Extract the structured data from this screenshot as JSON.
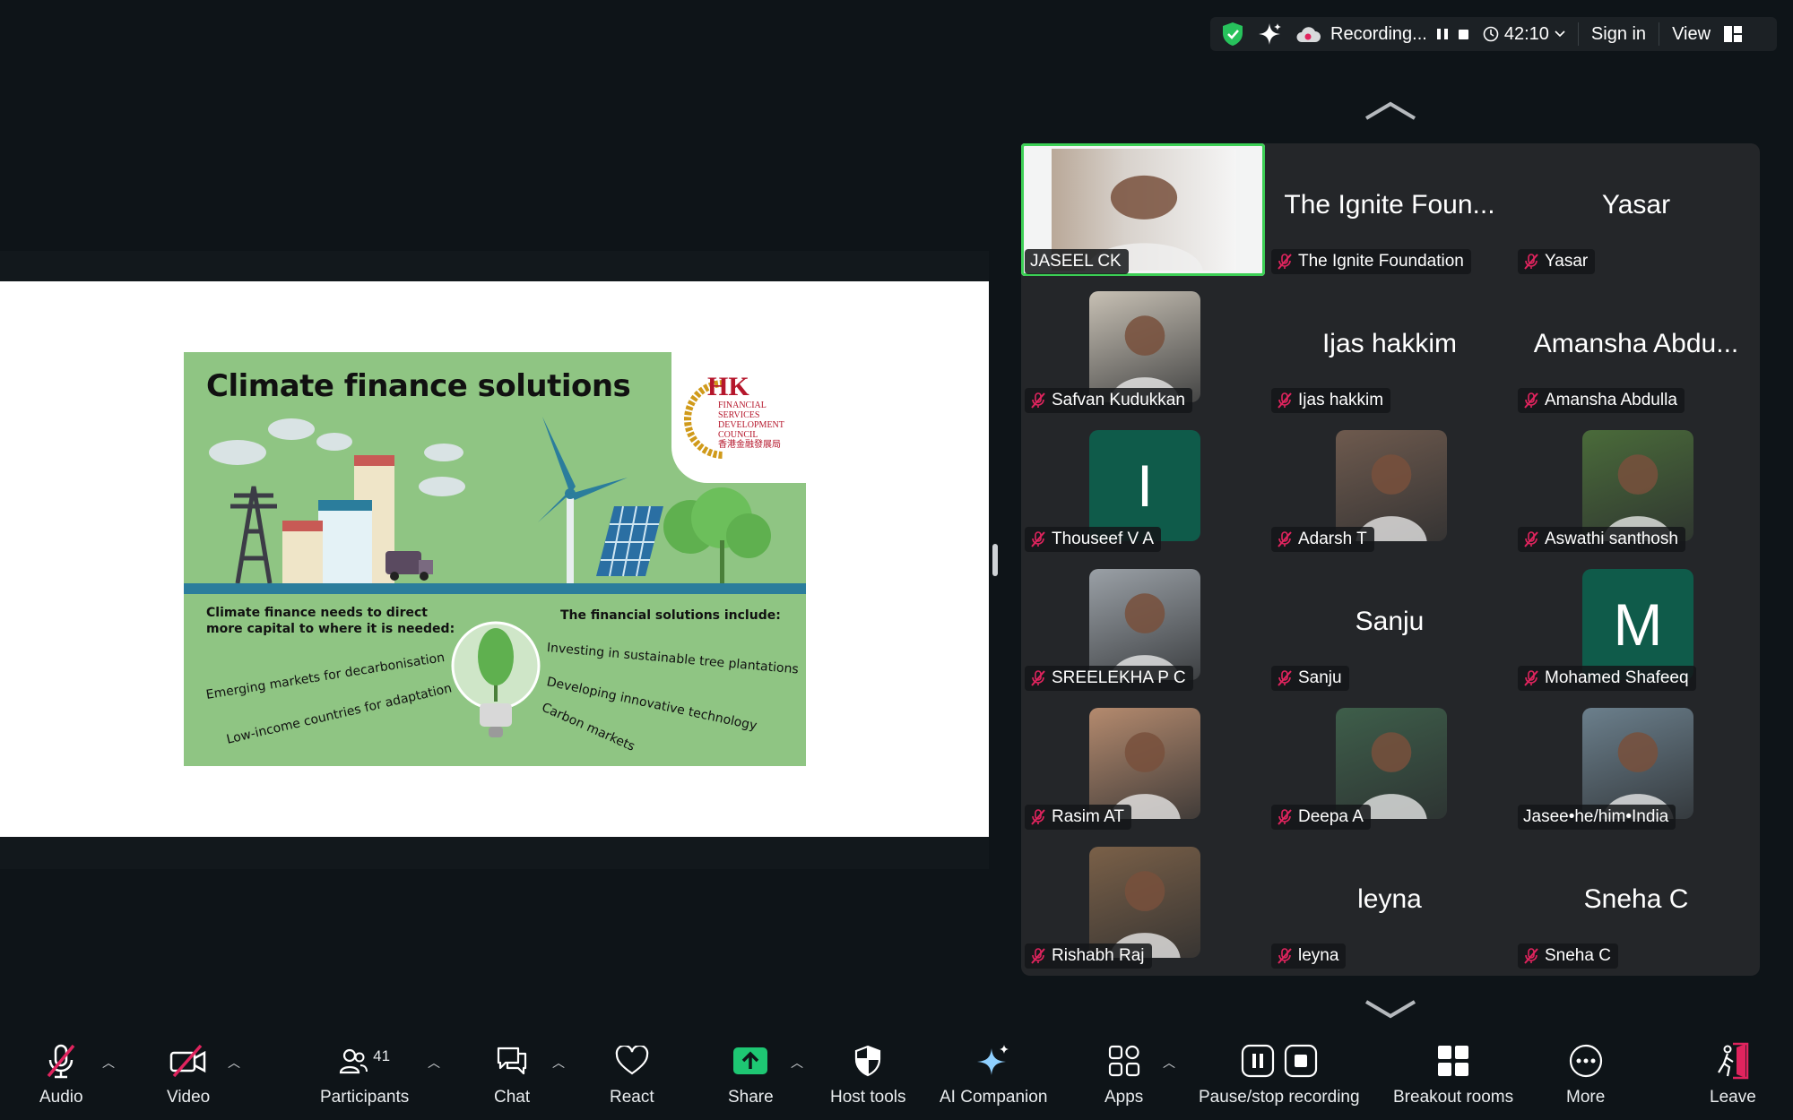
{
  "topbar": {
    "recording_label": "Recording...",
    "timer": "42:10",
    "sign_in": "Sign in",
    "view": "View"
  },
  "slide": {
    "title": "Climate finance solutions",
    "logo_text": "HK",
    "logo_sub": [
      "FINANCIAL",
      "SERVICES",
      "DEVELOPMENT",
      "COUNCIL",
      "香港金融發展局"
    ],
    "left_heading": "Climate finance needs to direct more capital to where it is needed:",
    "left_items": [
      "Emerging markets for decarbonisation",
      "Low-income countries for adaptation"
    ],
    "right_heading": "The financial solutions include:",
    "right_items": [
      "Investing in sustainable tree plantations",
      "Developing innovative technology",
      "Carbon markets"
    ]
  },
  "participants": [
    {
      "big": "",
      "label": "JASEEL CK",
      "muted": false,
      "kind": "video"
    },
    {
      "big": "The Ignite Foun...",
      "label": "The Ignite Foundation",
      "muted": true,
      "kind": "name"
    },
    {
      "big": "Yasar",
      "label": "Yasar",
      "muted": true,
      "kind": "name"
    },
    {
      "big": "",
      "label": "Safvan Kudukkan",
      "muted": true,
      "kind": "photo"
    },
    {
      "big": "Ijas hakkim",
      "label": "Ijas hakkim",
      "muted": true,
      "kind": "name"
    },
    {
      "big": "Amansha Abdu...",
      "label": "Amansha Abdulla",
      "muted": true,
      "kind": "name"
    },
    {
      "big": "I",
      "label": "Thouseef V A",
      "muted": true,
      "kind": "initial"
    },
    {
      "big": "",
      "label": "Adarsh T",
      "muted": true,
      "kind": "photo"
    },
    {
      "big": "",
      "label": "Aswathi santhosh",
      "muted": true,
      "kind": "photo"
    },
    {
      "big": "",
      "label": "SREELEKHA P C",
      "muted": true,
      "kind": "photo"
    },
    {
      "big": "Sanju",
      "label": "Sanju",
      "muted": true,
      "kind": "name"
    },
    {
      "big": "M",
      "label": "Mohamed Shafeeq",
      "muted": true,
      "kind": "initial"
    },
    {
      "big": "",
      "label": "Rasim AT",
      "muted": true,
      "kind": "photo"
    },
    {
      "big": "",
      "label": "Deepa A",
      "muted": true,
      "kind": "photo"
    },
    {
      "big": "",
      "label": "Jasee•he/him•India",
      "muted": false,
      "kind": "photo"
    },
    {
      "big": "",
      "label": "Rishabh Raj",
      "muted": true,
      "kind": "photo"
    },
    {
      "big": "leyna",
      "label": "leyna",
      "muted": true,
      "kind": "name"
    },
    {
      "big": "Sneha C",
      "label": "Sneha C",
      "muted": true,
      "kind": "name"
    }
  ],
  "toolbar": {
    "audio": "Audio",
    "video": "Video",
    "participants": "Participants",
    "participants_count": "41",
    "chat": "Chat",
    "react": "React",
    "share": "Share",
    "host_tools": "Host tools",
    "ai_companion": "AI Companion",
    "apps": "Apps",
    "pause_stop_recording": "Pause/stop recording",
    "breakout_rooms": "Breakout rooms",
    "more": "More",
    "leave": "Leave"
  },
  "colors": {
    "accent_green": "#3ccf55",
    "share_green": "#1ec773",
    "mute_red": "#e0245e",
    "leave_red": "#e0245e",
    "initial_bg": "#0f5b4a"
  }
}
